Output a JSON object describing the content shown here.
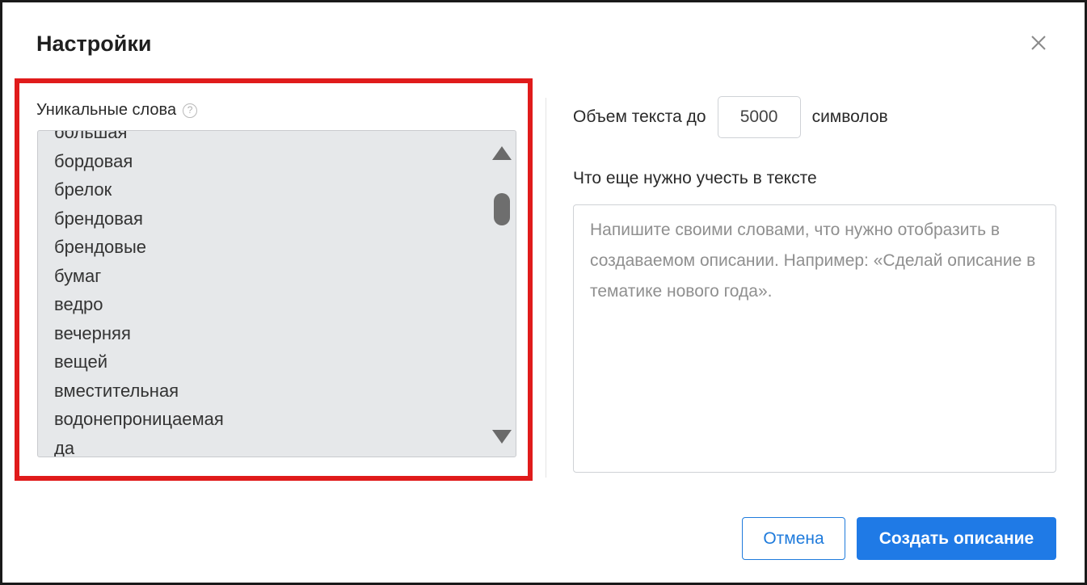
{
  "dialog": {
    "title": "Настройки",
    "close_icon": "close-icon"
  },
  "unique_words": {
    "label": "Уникальные слова",
    "help_icon": "help-circle-icon",
    "help_glyph": "?",
    "items": [
      "большая",
      "бордовая",
      "брелок",
      "брендовая",
      "брендовые",
      "бумаг",
      "ведро",
      "вечерняя",
      "вещей",
      "вместительная",
      "водонепроницаемая",
      "да"
    ]
  },
  "text_volume": {
    "prefix": "Объем текста до",
    "value": "5000",
    "suffix": "символов"
  },
  "extra_requirements": {
    "label": "Что еще нужно учесть в тексте",
    "placeholder": "Напишите своими словами, что нужно отобразить в создаваемом описании. Например: «Сделай описание в тематике нового года».",
    "value": ""
  },
  "buttons": {
    "cancel_label": "Отмена",
    "create_label": "Создать описание"
  },
  "colors": {
    "highlight": "#e01b1b",
    "primary": "#1f7ae6"
  }
}
